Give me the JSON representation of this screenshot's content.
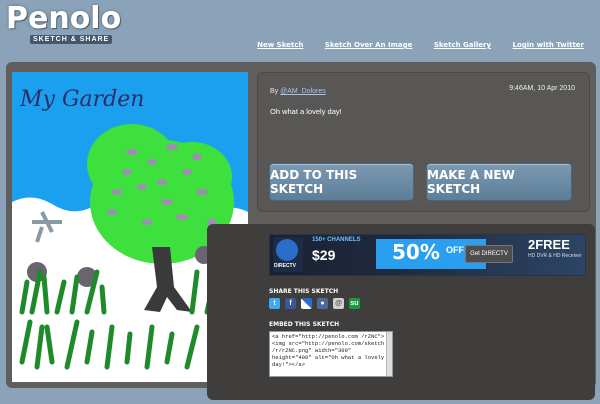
{
  "header": {
    "logo_title": "Penolo",
    "logo_tagline": "SKETCH & SHARE",
    "nav": [
      "New Sketch",
      "Sketch Over An Image",
      "Sketch Gallery",
      "Login with Twitter"
    ]
  },
  "sketch": {
    "title_text": "My Garden"
  },
  "info": {
    "by_label": "By",
    "author": "@AM_Dolores",
    "date": "9:46AM, 10 Apr 2010",
    "caption": "Oh what a lovely day!",
    "add_button": "ADD TO THIS SKETCH",
    "new_button": "MAKE A NEW SKETCH"
  },
  "ad": {
    "brand": "DIRECTV",
    "channels": "150+ CHANNELS",
    "price": "$29",
    "discount": "50%",
    "discount_suffix": "OFF",
    "cta": "Get DIRECTV",
    "free": "2FREE",
    "free_sub": "HD DVR & HD Receiver"
  },
  "share": {
    "title": "SHARE THIS SKETCH",
    "icons": [
      "twitter-icon",
      "facebook-icon",
      "delicious-icon",
      "myspace-icon",
      "email-icon",
      "stumbleupon-icon"
    ]
  },
  "embed": {
    "title": "EMBED THIS SKETCH",
    "code": "<a href=\"http://penolo.com /rZNC\"><img src=\"http://penolo.com/sketch /r/rZNC.png\" width=\"300\" height=\"400\" alt=\"Oh what a lovely day!\"></a>"
  },
  "colors": {
    "background": "#8ba3b8",
    "panel": "#5f5e5d",
    "button": "#6e8ca5"
  }
}
